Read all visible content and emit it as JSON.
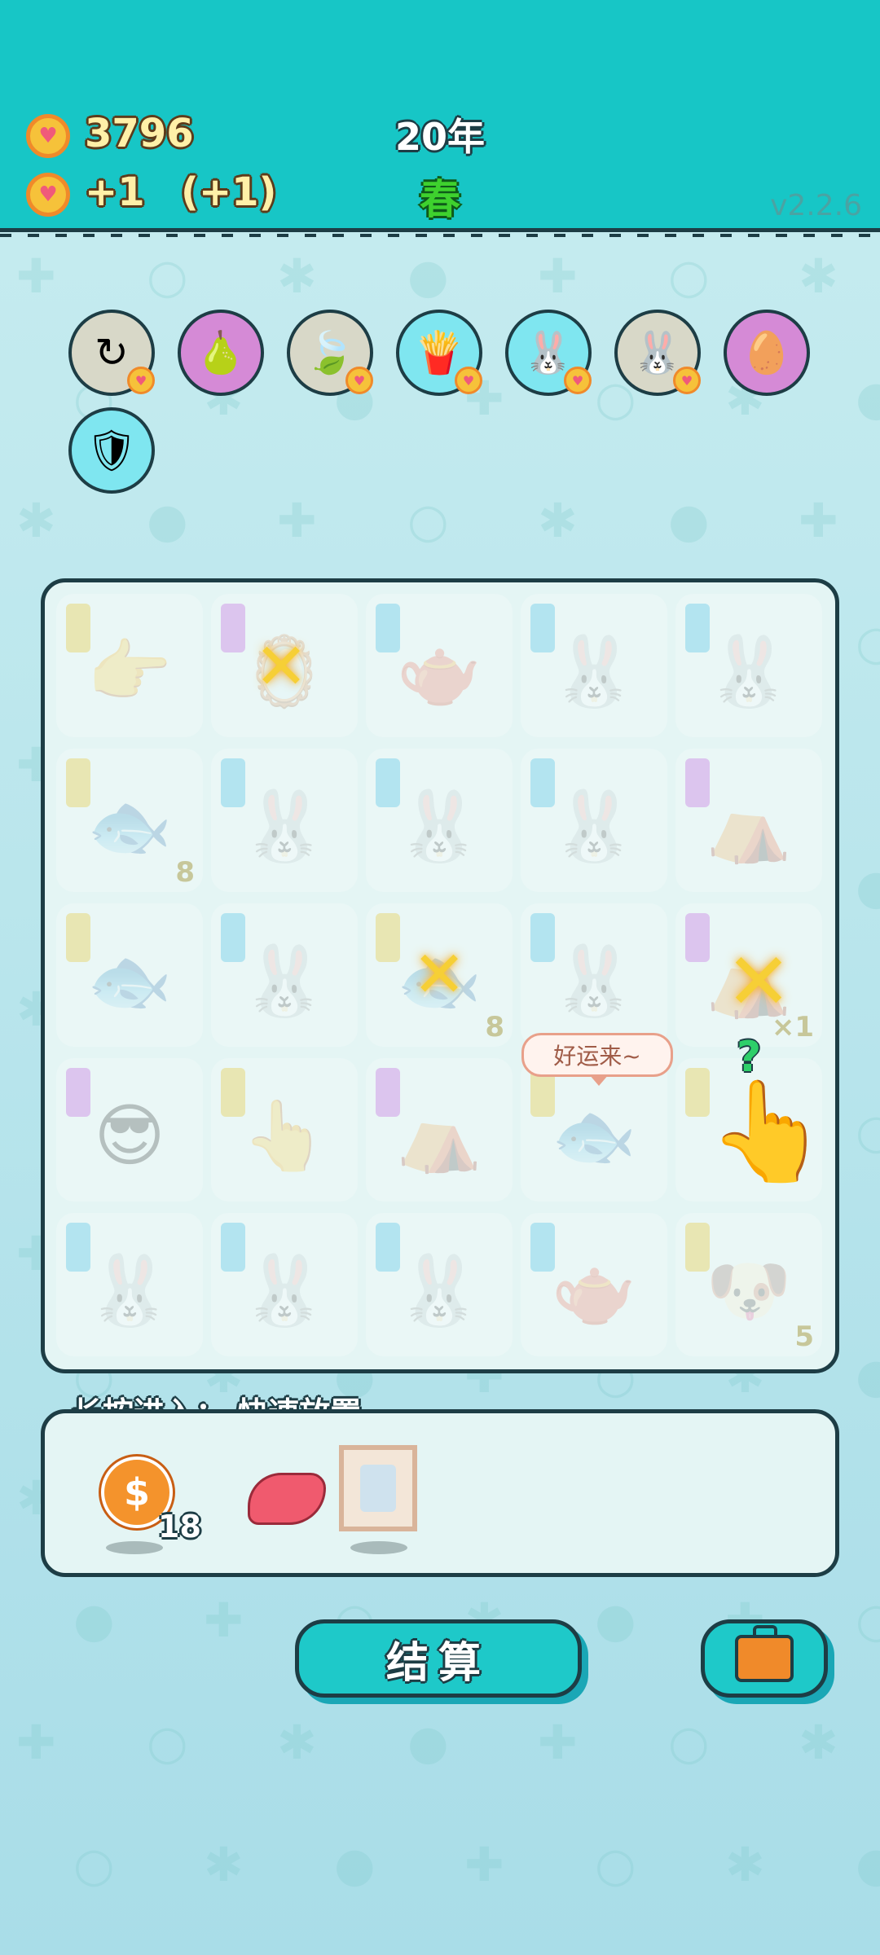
{
  "header": {
    "coins": "3796",
    "income": "+1",
    "income_bonus": "(+1)",
    "year": "20年",
    "season": "春",
    "version": "v2.2.6"
  },
  "items": [
    {
      "name": "refresh",
      "icon": "↻",
      "bg": "#d8d8c8",
      "heart": true
    },
    {
      "name": "pomelo",
      "icon": "🍐",
      "bg": "#d58ad6",
      "heart": false
    },
    {
      "name": "leaf",
      "icon": "🍃",
      "bg": "#d8d8c8",
      "heart": true
    },
    {
      "name": "fries",
      "icon": "🍟",
      "bg": "#7fe6f0",
      "heart": true
    },
    {
      "name": "rabbit",
      "icon": "🐰",
      "bg": "#7fe6f0",
      "heart": true
    },
    {
      "name": "rabbit",
      "icon": "🐰",
      "bg": "#d8d8c8",
      "heart": true
    },
    {
      "name": "egg",
      "icon": "🥚",
      "bg": "#d58ad6",
      "heart": false
    },
    {
      "name": "shield",
      "icon": "🛡",
      "bg": "#7fe6f0",
      "heart": false
    }
  ],
  "board": {
    "cells": [
      {
        "art": "👉",
        "tag": "#e6c93a",
        "count": ""
      },
      {
        "art": "🪞",
        "tag": "#c46be0",
        "count": ""
      },
      {
        "art": "🫖",
        "tag": "#4fc3e6",
        "count": ""
      },
      {
        "art": "🐰",
        "tag": "#4fc3e6",
        "count": ""
      },
      {
        "art": "🐰",
        "tag": "#4fc3e6",
        "count": ""
      },
      {
        "art": "🐟",
        "tag": "#e6c93a",
        "count": "8"
      },
      {
        "art": "🐰",
        "tag": "#4fc3e6",
        "count": ""
      },
      {
        "art": "🐰",
        "tag": "#4fc3e6",
        "count": ""
      },
      {
        "art": "🐰",
        "tag": "#4fc3e6",
        "count": ""
      },
      {
        "art": "⛺",
        "tag": "#c46be0",
        "count": ""
      },
      {
        "art": "🐟",
        "tag": "#e6c93a",
        "count": ""
      },
      {
        "art": "🐰",
        "tag": "#4fc3e6",
        "count": ""
      },
      {
        "art": "🐟",
        "tag": "#e6c93a",
        "count": "8"
      },
      {
        "art": "🐰",
        "tag": "#4fc3e6",
        "count": ""
      },
      {
        "art": "⛺",
        "tag": "#c46be0",
        "count": "×1"
      },
      {
        "art": "😎",
        "tag": "#c46be0",
        "count": ""
      },
      {
        "art": "👆",
        "tag": "#e6c93a",
        "count": ""
      },
      {
        "art": "⛺",
        "tag": "#c46be0",
        "count": ""
      },
      {
        "art": "🐟",
        "tag": "#e6c93a",
        "count": ""
      },
      {
        "art": "",
        "tag": "#e6c93a",
        "count": ""
      },
      {
        "art": "🐰",
        "tag": "#4fc3e6",
        "count": ""
      },
      {
        "art": "🐰",
        "tag": "#4fc3e6",
        "count": ""
      },
      {
        "art": "🐰",
        "tag": "#4fc3e6",
        "count": ""
      },
      {
        "art": "🫖",
        "tag": "#4fc3e6",
        "count": ""
      },
      {
        "art": "🐶",
        "tag": "#e6c93a",
        "count": "5"
      }
    ],
    "bubble": "好运来~",
    "question": "?"
  },
  "tray": {
    "label": "长按进入：  快速放置",
    "coin_count": "18",
    "coin_symbol": "$"
  },
  "buttons": {
    "settle": "结算"
  }
}
